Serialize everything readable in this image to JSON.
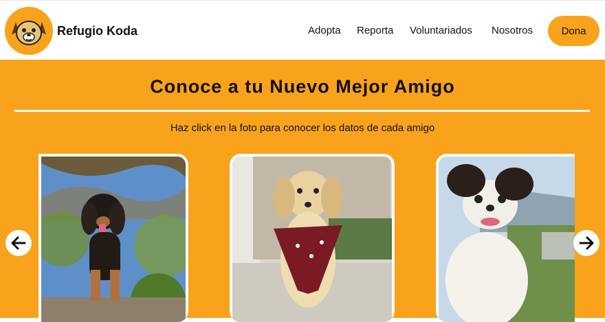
{
  "header": {
    "brand": "Refugio Koda",
    "nav": [
      "Adopta",
      "Reporta",
      "Voluntariados",
      "Nosotros"
    ],
    "donate_label": "Dona"
  },
  "hero": {
    "title": "Conoce a tu Nuevo Mejor Amigo",
    "subtitle": "Haz click en la foto para conocer los datos de cada amigo"
  },
  "carousel": {
    "cards": [
      {
        "photo": "black-and-tan-dog-under-tree"
      },
      {
        "photo": "cream-puppy-with-red-bandana"
      },
      {
        "photo": "papillon-dog-mountain-view"
      }
    ],
    "prev_icon": "arrow-left-icon",
    "next_icon": "arrow-right-icon"
  },
  "colors": {
    "accent": "#F9A21B",
    "text": "#111111"
  }
}
